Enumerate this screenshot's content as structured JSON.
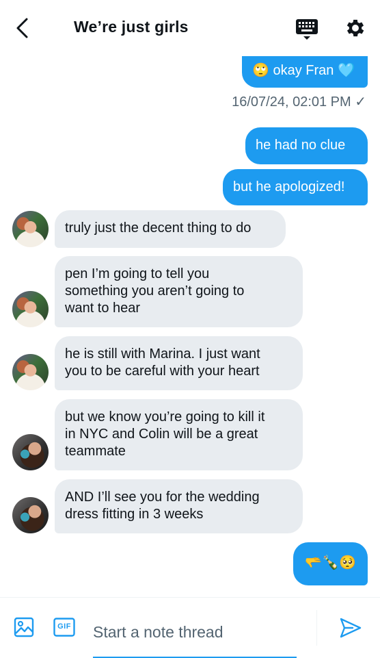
{
  "header": {
    "title": "We’re just girls",
    "icons": {
      "back": "chevron-left-icon",
      "keyboard": "keyboard-icon",
      "settings": "gear-icon"
    }
  },
  "messages": [
    {
      "type": "outgoing",
      "text": "okay Fran",
      "emoji_before": "🙄",
      "emoji_after": "🩵"
    },
    {
      "type": "timestamp",
      "text": "16/07/24, 02:01 PM ✓"
    },
    {
      "type": "outgoing",
      "text": "he had no clue"
    },
    {
      "type": "outgoing",
      "text": "but he apologized!"
    },
    {
      "type": "incoming",
      "text": "truly just the decent thing to do"
    },
    {
      "type": "incoming",
      "lines": [
        "pen I’m going to tell you",
        "something you aren’t going to",
        "want to hear"
      ]
    },
    {
      "type": "incoming",
      "lines": [
        "he is still with Marina. I just want",
        "you to be careful with your heart"
      ]
    },
    {
      "type": "incoming",
      "lines": [
        "but we know you’re going to kill it",
        "in NYC and Colin will be a great",
        "teammate"
      ]
    },
    {
      "type": "incoming",
      "lines": [
        "AND I’ll see you for the wedding",
        "dress fitting in 3 weeks"
      ]
    },
    {
      "type": "outgoing",
      "text": "🫳🍾🥺"
    }
  ],
  "composer": {
    "placeholder": "Start a note thread",
    "gif_label": "GIF",
    "icons": {
      "media": "image-icon",
      "gif": "gif-icon",
      "send": "send-icon"
    }
  },
  "colors": {
    "accent": "#1d9bf0",
    "incoming_bubble": "#e8ecf0",
    "muted_text": "#536471"
  }
}
